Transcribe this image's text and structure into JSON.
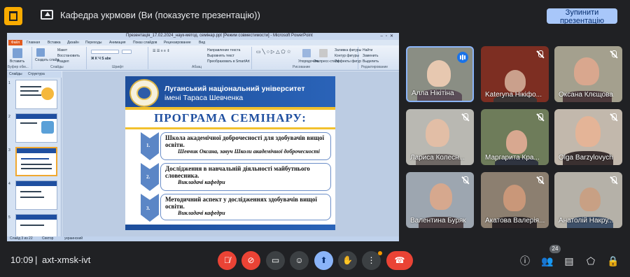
{
  "topbar": {
    "title": "Кафедра укрмови (Ви (показуєте презентацію))",
    "stop_presenting": "Зупинити презентацію"
  },
  "ppt": {
    "window_title": "Презентація_17.02.2024_наук-метод. семінар.ppt [Режим совместимости] - Microsoft PowerPoint",
    "menu": [
      "Главная",
      "Вставка",
      "Дизайн",
      "Переходы",
      "Анимация",
      "Показ слайдов",
      "Рецензирование",
      "Вид"
    ],
    "file_label": "Файл",
    "ribbon": {
      "paste": "Вставить",
      "cut": "Вырезать",
      "copy": "Копировать",
      "create_slide": "Создать слайд",
      "layout": "Макет",
      "reset": "Восстановить",
      "section": "Раздел",
      "group_clipboard": "Буфер обм...",
      "group_slides": "Слайды",
      "group_font": "Шрифт",
      "group_paragraph": "Абзац",
      "group_drawing": "Рисование",
      "group_editing": "Редактирование",
      "text_dir": "Направление текста",
      "align_text": "Выровнять текст",
      "smartart": "Преобразовать в SmartArt",
      "arrange": "Упорядочить",
      "quick_styles": "Экспресс-стили",
      "fill": "Заливка фигуры",
      "outline": "Контур фигуры",
      "effects": "Эффекты фигур",
      "find": "Найти",
      "replace": "Заменить",
      "select": "Выделить"
    },
    "panel_tabs": [
      "Слайды",
      "Структура"
    ],
    "thumb_numbers": [
      "1",
      "2",
      "3",
      "4",
      "5"
    ],
    "status": {
      "slide": "Слайд 3 из 22",
      "theme": "Сектор",
      "lang": "украинский"
    }
  },
  "slide": {
    "university_line1": "Луганський національний університет",
    "university_line2": "імені Тараса Шевченка",
    "heading": "ПРОГРАМА СЕМІНАРУ:",
    "items": [
      {
        "num": "1.",
        "title": "Школа академічної доброчесності для здобувачів вищої освіти.",
        "speaker": "Шевчик Оксана,  завуч Школи академічної доброчесності"
      },
      {
        "num": "2.",
        "title": "Дослідження в навчальній діяльності майбутнього словесника.",
        "speaker": "Викладачі кафедри"
      },
      {
        "num": "3.",
        "title": "Методичний аспект у дослідженнях здобувачів вищої освіти.",
        "speaker": "Викладачі кафедри"
      }
    ]
  },
  "participants": [
    {
      "name": "Алла Нікітіна"
    },
    {
      "name": "Kateryna Нікіфо..."
    },
    {
      "name": "Оксана Клєщова"
    },
    {
      "name": "Лариса Колесн..."
    },
    {
      "name": "Маргарита Кра..."
    },
    {
      "name": "Olga Barzylovych"
    },
    {
      "name": "Валентина Буряк"
    },
    {
      "name": "Акатова Валерія..."
    },
    {
      "name": "Анатолій Накру..."
    }
  ],
  "bottombar": {
    "time": "10:09",
    "separator": "|",
    "meeting_code": "axt-xmsk-ivt",
    "participant_count": "24"
  },
  "colors": {
    "accent": "#8ab4f8",
    "danger": "#ea4335",
    "background": "#202124"
  }
}
